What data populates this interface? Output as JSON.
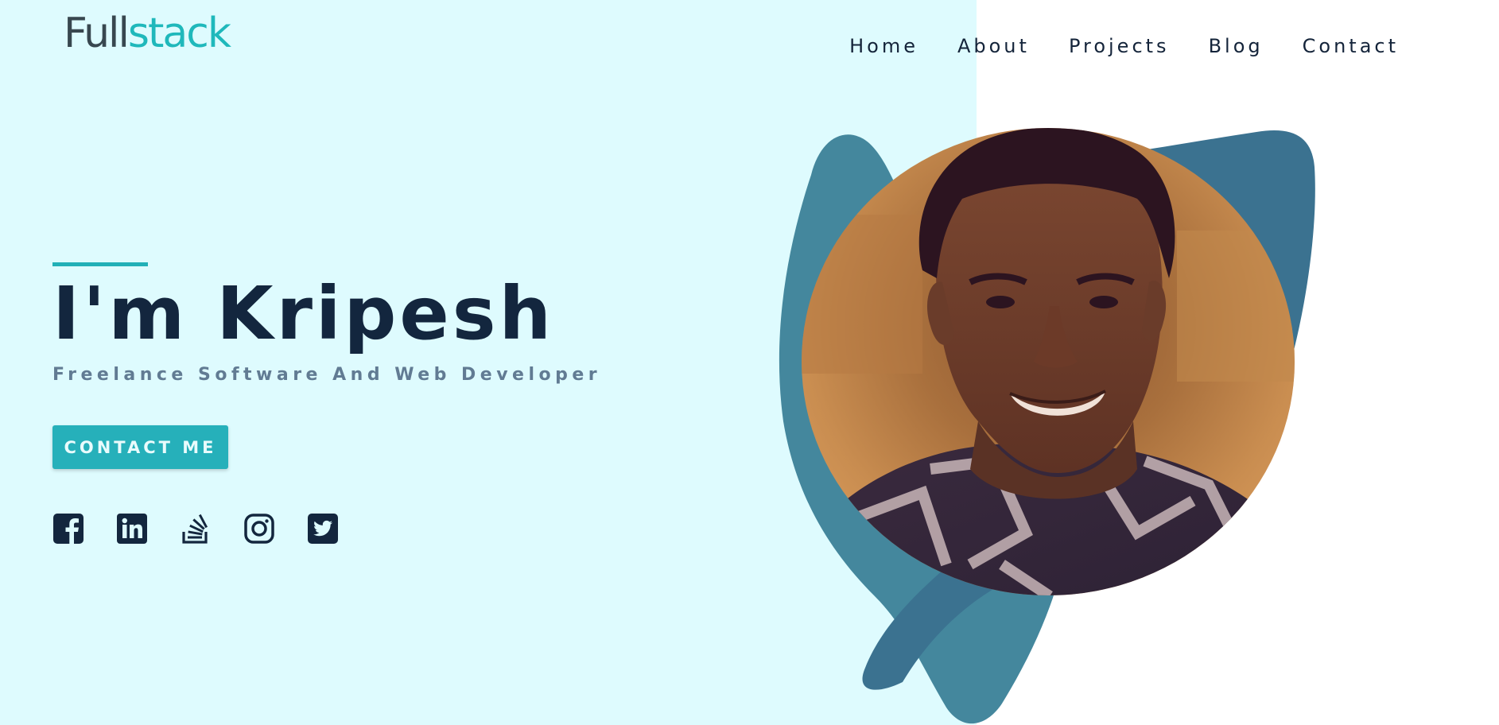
{
  "logo": {
    "part1": "Full",
    "part2": "stack"
  },
  "nav": {
    "items": [
      {
        "label": "Home"
      },
      {
        "label": "About"
      },
      {
        "label": "Projects"
      },
      {
        "label": "Blog"
      },
      {
        "label": "Contact"
      }
    ]
  },
  "hero": {
    "title": "I'm Kripesh",
    "subtitle": "Freelance Software And Web Developer",
    "cta_label": "CONTACT ME"
  },
  "socials": [
    {
      "icon": "facebook-icon"
    },
    {
      "icon": "linkedin-icon"
    },
    {
      "icon": "stackoverflow-icon"
    },
    {
      "icon": "instagram-icon"
    },
    {
      "icon": "twitter-icon"
    }
  ],
  "colors": {
    "background_left": "#defbfe",
    "background_right": "#ffffff",
    "accent": "#26b0ba",
    "heading": "#13263e",
    "subtitle": "#617b93",
    "blob_dark": "#3b7290",
    "blob_light": "#44879d"
  },
  "portrait": {
    "icon": "profile-photo"
  }
}
